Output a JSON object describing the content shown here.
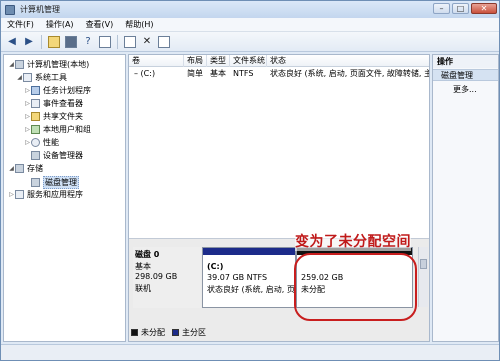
{
  "window": {
    "title": "计算机管理"
  },
  "caption": {
    "minimize": "–",
    "maximize": "□",
    "close": "✕"
  },
  "menu": [
    "文件(F)",
    "操作(A)",
    "查看(V)",
    "帮助(H)"
  ],
  "toolbar": {
    "back": "◀",
    "forward": "▶",
    "help": "?",
    "delete": "✕"
  },
  "tree": {
    "root": "计算机管理(本地)",
    "system_tools": "系统工具",
    "task_scheduler": "任务计划程序",
    "event_viewer": "事件查看器",
    "shared_folders": "共享文件夹",
    "local_users": "本地用户和组",
    "performance": "性能",
    "device_manager": "设备管理器",
    "storage": "存储",
    "disk_management": "磁盘管理",
    "services": "服务和应用程序"
  },
  "list": {
    "columns": [
      "卷",
      "布局",
      "类型",
      "文件系统",
      "状态"
    ],
    "rows": [
      {
        "volume": "(C:)",
        "layout": "简单",
        "type": "基本",
        "fs": "NTFS",
        "status": "状态良好 (系统, 启动, 页面文件, 故障转储, 主分区)"
      }
    ]
  },
  "disk": {
    "name": "磁盘 0",
    "type": "基本",
    "size": "298.09 GB",
    "state": "联机",
    "partitions": [
      {
        "name": "(C:)",
        "size": "39.07 GB NTFS",
        "status": "状态良好 (系统, 启动, 页面"
      },
      {
        "name": "",
        "size": "259.02 GB",
        "status": "未分配"
      }
    ]
  },
  "legend": [
    {
      "label": "未分配",
      "color": "#111111"
    },
    {
      "label": "主分区",
      "color": "#1c2b8a"
    }
  ],
  "annotation": "变为了未分配空间",
  "actions": {
    "title": "操作",
    "section": "磁盘管理",
    "more": "更多..."
  }
}
